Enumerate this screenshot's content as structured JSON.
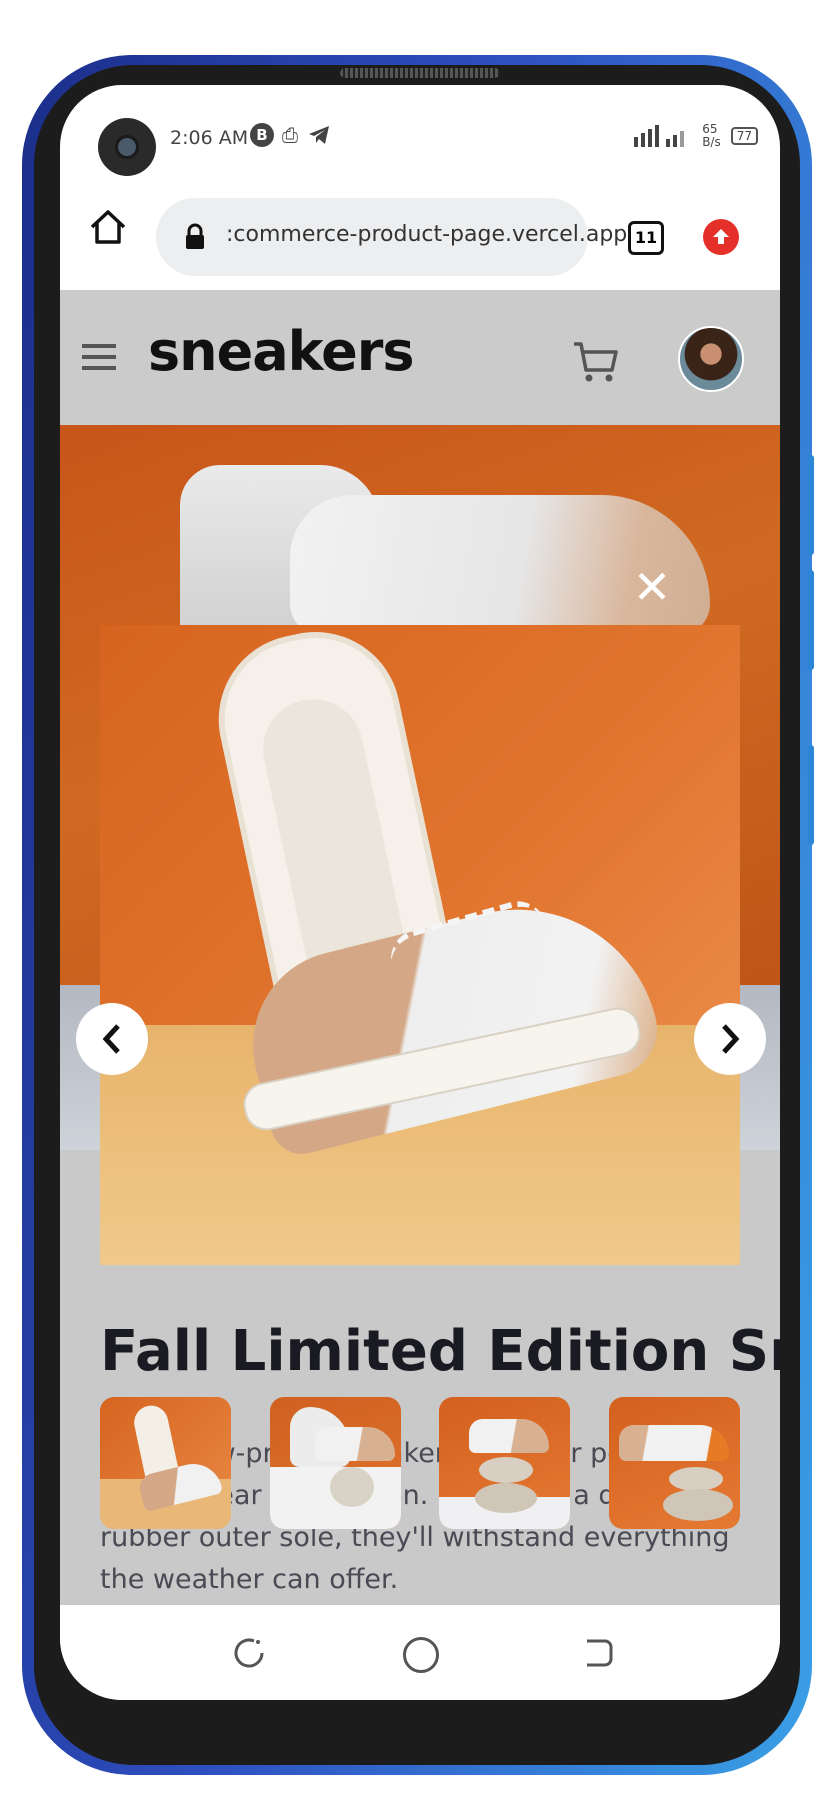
{
  "status_bar": {
    "time": "2:06 AM",
    "net_speed_top": "65",
    "net_speed_unit": "B/s",
    "battery": "77"
  },
  "browser": {
    "url": ":commerce-product-page.vercel.app",
    "tab_count": "11"
  },
  "site": {
    "logo": "sneakers"
  },
  "product": {
    "title": "Fall Limited Edition Sneakers",
    "description": "These low-profile sneakers are your perfect casual wear companion. Featuring a durable rubber outer sole, they'll withstand everything the weather can offer."
  },
  "lightbox": {
    "close_symbol": "✕",
    "thumbnails": [
      "Product thumbnail 1",
      "Product thumbnail 2",
      "Product thumbnail 3",
      "Product thumbnail 4"
    ]
  },
  "colors": {
    "accent_orange": "#d6641f",
    "header_gray": "#cbcbcb"
  },
  "icons": [
    "home-icon",
    "lock-icon",
    "tabs-icon",
    "upload-icon",
    "menu-icon",
    "cart-icon",
    "close-icon",
    "chevron-left-icon",
    "chevron-right-icon",
    "nav-back-icon",
    "nav-home-icon",
    "nav-recent-icon"
  ]
}
